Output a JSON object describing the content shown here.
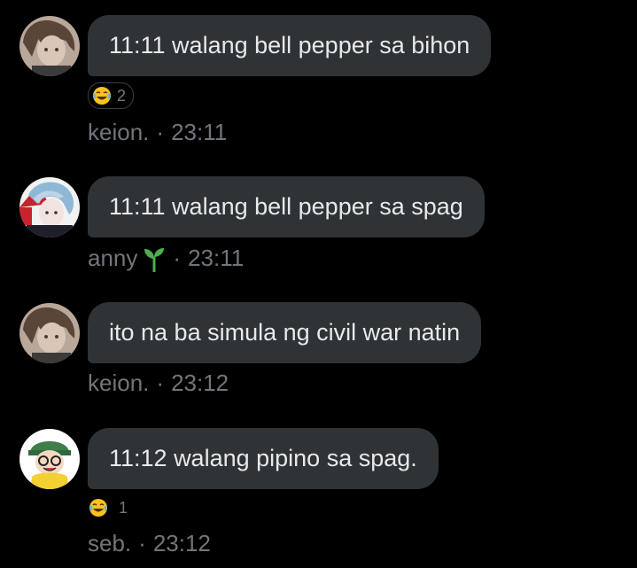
{
  "messages": [
    {
      "sender": "keion.",
      "time": "23:11",
      "text": "11:11 walang bell pepper sa bihon",
      "reaction": {
        "emoji": "face-with-tears-of-joy-icon",
        "count": "2"
      }
    },
    {
      "sender": "anny",
      "time": "23:11",
      "text": "11:11 walang bell pepper sa spag",
      "sender_badge": "seedling-icon"
    },
    {
      "sender": "keion.",
      "time": "23:12",
      "text": "ito na ba simula ng civil war natin"
    },
    {
      "sender": "seb.",
      "time": "23:12",
      "text": "11:12 walang pipino sa spag.",
      "reaction": {
        "emoji": "face-with-tears-of-joy-icon",
        "count": "1"
      }
    }
  ],
  "separator": "·",
  "colors": {
    "background": "#000000",
    "bubble": "#2f3336",
    "text": "#e7e9ea",
    "meta": "#71767b",
    "sprout": "#4caf50"
  }
}
